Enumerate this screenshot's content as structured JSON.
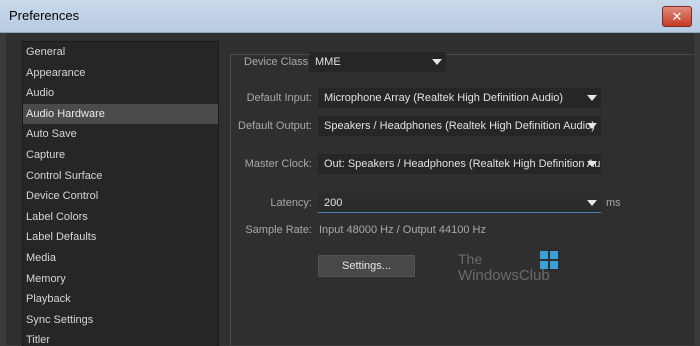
{
  "window": {
    "title": "Preferences",
    "close_symbol": "✕"
  },
  "sidebar": {
    "items": [
      {
        "label": "General"
      },
      {
        "label": "Appearance"
      },
      {
        "label": "Audio"
      },
      {
        "label": "Audio Hardware",
        "selected": true
      },
      {
        "label": "Auto Save"
      },
      {
        "label": "Capture"
      },
      {
        "label": "Control Surface"
      },
      {
        "label": "Device Control"
      },
      {
        "label": "Label Colors"
      },
      {
        "label": "Label Defaults"
      },
      {
        "label": "Media"
      },
      {
        "label": "Memory"
      },
      {
        "label": "Playback"
      },
      {
        "label": "Sync Settings"
      },
      {
        "label": "Titler"
      }
    ]
  },
  "audio_hardware": {
    "device_class": {
      "label": "Device Class:",
      "value": "MME"
    },
    "default_input": {
      "label": "Default Input:",
      "value": "Microphone Array (Realtek High Definition Audio)"
    },
    "default_output": {
      "label": "Default Output:",
      "value": "Speakers / Headphones (Realtek High Definition Audio)"
    },
    "master_clock": {
      "label": "Master Clock:",
      "value": "Out: Speakers / Headphones (Realtek High Definition Au"
    },
    "latency": {
      "label": "Latency:",
      "value": "200",
      "unit": "ms"
    },
    "sample_rate": {
      "label": "Sample Rate:",
      "value": "Input 48000 Hz / Output 44100 Hz"
    },
    "settings_button": "Settings..."
  },
  "watermark": {
    "line1": "The",
    "line2": "WindowsClub"
  },
  "colors": {
    "accent": "#4d7fb8",
    "background": "#2f2f2f",
    "title_bar": "#c9d8ea"
  }
}
